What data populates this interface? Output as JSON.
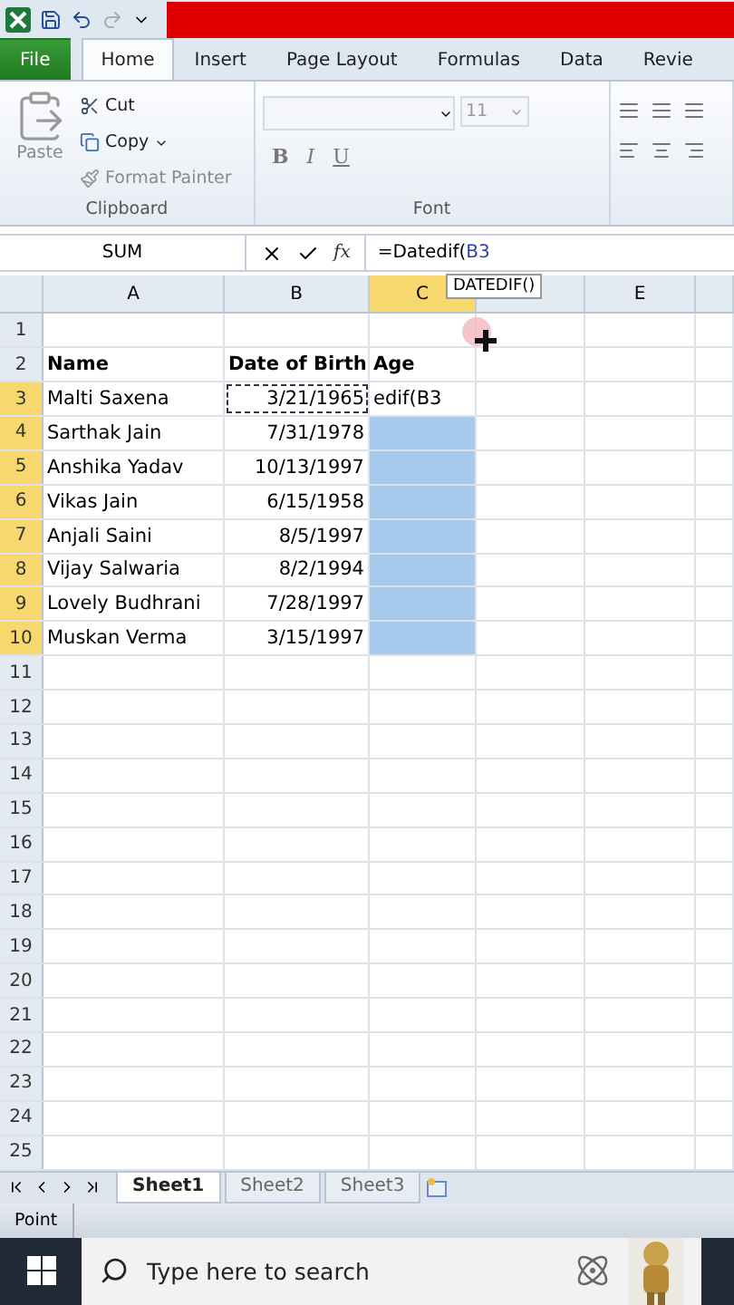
{
  "ribbon_tabs": [
    {
      "label": "File",
      "kind": "file",
      "selected": false
    },
    {
      "label": "Home",
      "kind": "tab",
      "selected": true
    },
    {
      "label": "Insert",
      "kind": "tab",
      "selected": false
    },
    {
      "label": "Page Layout",
      "kind": "tab",
      "selected": false
    },
    {
      "label": "Formulas",
      "kind": "tab",
      "selected": false
    },
    {
      "label": "Data",
      "kind": "tab",
      "selected": false
    },
    {
      "label": "Revie",
      "kind": "tab",
      "selected": false
    }
  ],
  "clipboard": {
    "paste": "Paste",
    "cut": "Cut",
    "copy": "Copy",
    "format_painter": "Format Painter",
    "group_label": "Clipboard"
  },
  "font": {
    "size": "11",
    "bold": "B",
    "italic": "I",
    "underline": "U",
    "group_label": "Font"
  },
  "formula_bar": {
    "name_box": "SUM",
    "fx": "fx",
    "formula": "=Datedif(",
    "formula_ref": "B3",
    "tooltip": "DATEDIF()"
  },
  "columns": [
    {
      "label": "A",
      "selected": false
    },
    {
      "label": "B",
      "selected": false
    },
    {
      "label": "C",
      "selected": true
    },
    {
      "selected": false
    },
    {
      "label": "E",
      "selected": false
    }
  ],
  "rows": [
    {
      "number": "1",
      "selected": false,
      "age_highlighted": false
    },
    {
      "number": "2",
      "selected": false,
      "name": "Name",
      "date_of_birth": "Date of Birth",
      "age": "Age",
      "header": true,
      "age_highlighted": false
    },
    {
      "number": "3",
      "selected": true,
      "name": "Malti Saxena",
      "date_of_birth": "3/21/1965",
      "age": "edif(B3",
      "referenced": true,
      "age_highlighted": false
    },
    {
      "number": "4",
      "selected": true,
      "name": "Sarthak Jain",
      "date_of_birth": "7/31/1978",
      "age_highlighted": true
    },
    {
      "number": "5",
      "selected": true,
      "name": "Anshika Yadav",
      "date_of_birth": "10/13/1997",
      "age_highlighted": true
    },
    {
      "number": "6",
      "selected": true,
      "name": "Vikas Jain",
      "date_of_birth": "6/15/1958",
      "age_highlighted": true
    },
    {
      "number": "7",
      "selected": true,
      "name": "Anjali Saini",
      "date_of_birth": "8/5/1997",
      "age_highlighted": true
    },
    {
      "number": "8",
      "selected": true,
      "name": "Vijay  Salwaria",
      "date_of_birth": "8/2/1994",
      "age_highlighted": true
    },
    {
      "number": "9",
      "selected": true,
      "name": "Lovely Budhrani",
      "date_of_birth": "7/28/1997",
      "age_highlighted": true
    },
    {
      "number": "10",
      "selected": true,
      "name": "Muskan Verma",
      "date_of_birth": "3/15/1997",
      "age_highlighted": true
    },
    {
      "number": "11",
      "selected": false,
      "age_highlighted": false
    },
    {
      "number": "12",
      "selected": false,
      "age_highlighted": false
    },
    {
      "number": "13",
      "selected": false,
      "age_highlighted": false
    },
    {
      "number": "14",
      "selected": false,
      "age_highlighted": false
    },
    {
      "number": "15",
      "selected": false,
      "age_highlighted": false
    },
    {
      "number": "16",
      "selected": false,
      "age_highlighted": false
    },
    {
      "number": "17",
      "selected": false,
      "age_highlighted": false
    },
    {
      "number": "18",
      "selected": false,
      "age_highlighted": false
    },
    {
      "number": "19",
      "selected": false,
      "age_highlighted": false
    },
    {
      "number": "20",
      "selected": false,
      "age_highlighted": false
    },
    {
      "number": "21",
      "selected": false,
      "age_highlighted": false
    },
    {
      "number": "22",
      "selected": false,
      "age_highlighted": false
    },
    {
      "number": "23",
      "selected": false,
      "age_highlighted": false
    },
    {
      "number": "24",
      "selected": false,
      "age_highlighted": false
    },
    {
      "number": "25",
      "selected": false,
      "age_highlighted": false
    }
  ],
  "sheet_tabs": [
    {
      "label": "Sheet1",
      "selected": true
    },
    {
      "label": "Sheet2",
      "selected": false
    },
    {
      "label": "Sheet3",
      "selected": false
    }
  ],
  "status_bar": {
    "mode": "Point"
  },
  "taskbar": {
    "search_placeholder": "Type here to search"
  }
}
